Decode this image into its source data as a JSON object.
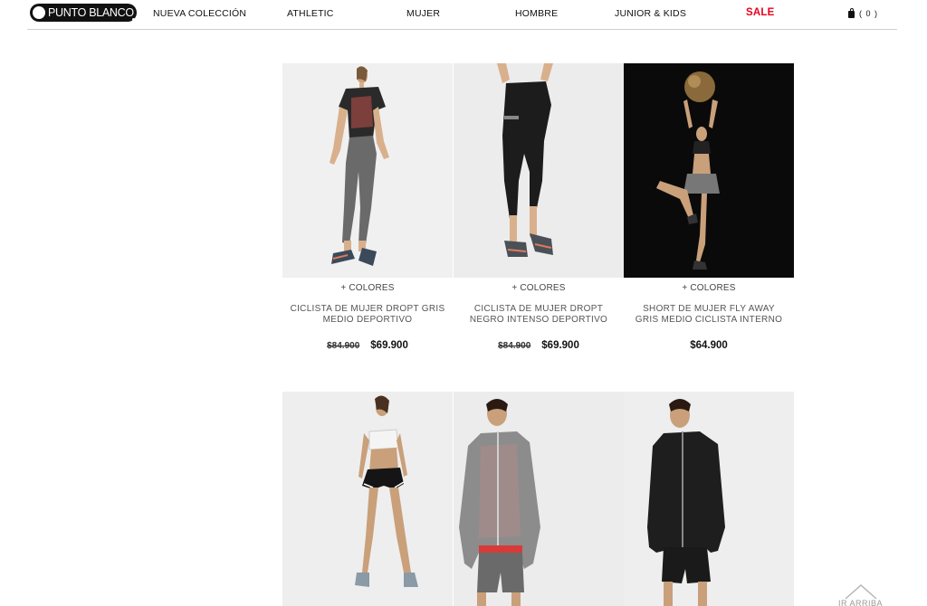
{
  "brand": {
    "logo_text": "PUNTO BLANCO"
  },
  "nav": {
    "items": [
      {
        "label": "NUEVA COLECCIÓN"
      },
      {
        "label": "ATHLETIC"
      },
      {
        "label": "MUJER"
      },
      {
        "label": "HOMBRE"
      },
      {
        "label": "JUNIOR & KIDS"
      },
      {
        "label": "SALE",
        "color": "#e8001c"
      }
    ],
    "cart_count": "( 0 )"
  },
  "products": [
    {
      "colors_label": "+ COLORES",
      "name": "CICLISTA DE MUJER DROPT GRIS MEDIO DEPORTIVO",
      "old_price": "$84.900",
      "price": "$69.900"
    },
    {
      "colors_label": "+ COLORES",
      "name": "CICLISTA DE MUJER DROPT NEGRO INTENSO DEPORTIVO",
      "old_price": "$84.900",
      "price": "$69.900"
    },
    {
      "colors_label": "+ COLORES",
      "name": "SHORT DE MUJER FLY AWAY GRIS MEDIO CICLISTA INTERNO",
      "old_price": "",
      "price": "$64.900"
    },
    {
      "colors_label": "",
      "name": "",
      "old_price": "",
      "price": ""
    },
    {
      "colors_label": "",
      "name": "",
      "old_price": "",
      "price": ""
    },
    {
      "colors_label": "",
      "name": "",
      "old_price": "",
      "price": ""
    }
  ],
  "back_to_top": {
    "label": "IR ARRIBA"
  },
  "colors": {
    "sale": "#e8001c",
    "dark_bg": "#0a0a0a",
    "photo_bg": "#eeeeee"
  }
}
